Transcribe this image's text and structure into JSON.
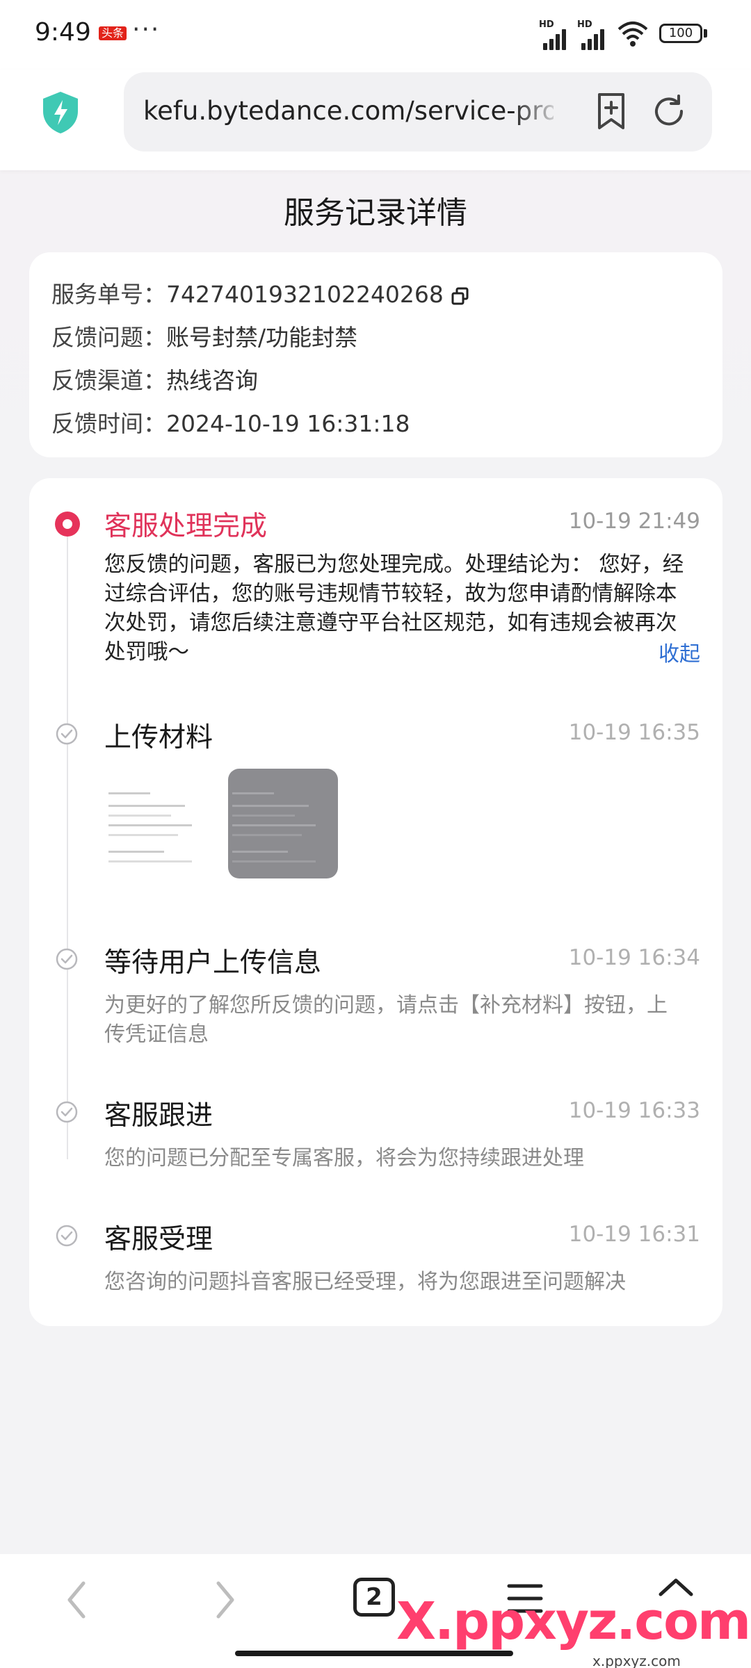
{
  "status_bar": {
    "time": "9:49",
    "news_badge": "头条",
    "dots": "···",
    "signal_label": "HD",
    "battery": "100"
  },
  "browser": {
    "url": "kefu.bytedance.com/service-pro"
  },
  "page": {
    "title": "服务记录详情"
  },
  "info": {
    "rows": [
      {
        "label": "服务单号：",
        "value": "7427401932102240268"
      },
      {
        "label": "反馈问题：",
        "value": "账号封禁/功能封禁"
      },
      {
        "label": "反馈渠道：",
        "value": "热线咨询"
      },
      {
        "label": "反馈时间：",
        "value": "2024-10-19 16:31:18"
      }
    ]
  },
  "timeline": [
    {
      "title": "客服处理完成",
      "time": "10-19 21:49",
      "lines": [
        "您反馈的问题，客服已为您处理完成。处理结论为： 您好，经",
        "过综合评估，您的账号违规情节较轻，故为您申请酌情解除本",
        "次处罚，请您后续注意遵守平台社区规范，如有违规会被再次",
        "处罚哦～"
      ],
      "action": "收起",
      "status": "active",
      "accent_color": "#e0335a"
    },
    {
      "title": "上传材料",
      "time": "10-19 16:35",
      "status": "done"
    },
    {
      "title": "等待用户上传信息",
      "time": "10-19 16:34",
      "lines": [
        "为更好的了解您所反馈的问题，请点击【补充材料】按钮，上",
        "传凭证信息"
      ],
      "status": "done"
    },
    {
      "title": "客服跟进",
      "time": "10-19 16:33",
      "lines": [
        "您的问题已分配至专属客服，将会为您持续跟进处理"
      ],
      "status": "done"
    },
    {
      "title": "客服受理",
      "time": "10-19 16:31",
      "lines": [
        "您咨询的问题抖音客服已经受理，将为您跟进至问题解决"
      ],
      "status": "done"
    }
  ],
  "bottom_nav": {
    "tab_count": "2"
  },
  "watermark": {
    "main": "X.ppxyz.com",
    "sub": "x.ppxyz.com"
  }
}
